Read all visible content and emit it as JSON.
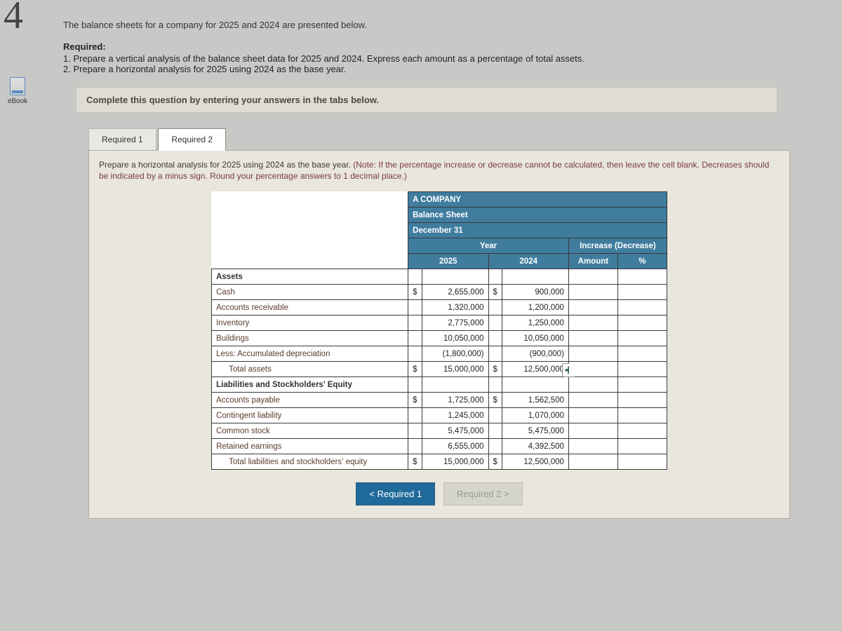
{
  "question_number": "4",
  "sidebar": {
    "ebook_label": "eBook"
  },
  "intro": "The balance sheets for a company for 2025 and 2024 are presented below.",
  "required_heading": "Required:",
  "required_items": [
    "1. Prepare a vertical analysis of the balance sheet data for 2025 and 2024. Express each amount as a percentage of total assets.",
    "2. Prepare a horizontal analysis for 2025 using 2024 as the base year."
  ],
  "complete_bar": "Complete this question by entering your answers in the tabs below.",
  "tabs": {
    "t1": "Required 1",
    "t2": "Required 2"
  },
  "instruction_main": "Prepare a horizontal analysis for 2025 using 2024 as the base year. ",
  "instruction_note": "(Note: If the percentage increase or decrease cannot be calculated, then leave the cell blank. Decreases should be indicated by a minus sign. Round your percentage answers to 1 decimal place.)",
  "table": {
    "title1": "A COMPANY",
    "title2": "Balance Sheet",
    "title3": "December 31",
    "year_hdr": "Year",
    "inc_hdr": "Increase (Decrease)",
    "col_2025": "2025",
    "col_2024": "2024",
    "col_amount": "Amount",
    "col_pct": "%",
    "sections": {
      "assets": "Assets",
      "liab": "Liabilities and Stockholders' Equity"
    },
    "rows": [
      {
        "label": "Cash",
        "c25": "$",
        "v25": "2,655,000",
        "c24": "$",
        "v24": "900,000"
      },
      {
        "label": "Accounts receivable",
        "v25": "1,320,000",
        "v24": "1,200,000"
      },
      {
        "label": "Inventory",
        "v25": "2,775,000",
        "v24": "1,250,000"
      },
      {
        "label": "Buildings",
        "v25": "10,050,000",
        "v24": "10,050,000"
      },
      {
        "label": "Less: Accumulated depreciation",
        "v25": "(1,800,000)",
        "v24": "(900,000)"
      },
      {
        "label": "Total assets",
        "indent": true,
        "c25": "$",
        "v25": "15,000,000",
        "c24": "$",
        "v24": "12,500,000"
      }
    ],
    "rows2": [
      {
        "label": "Accounts payable",
        "c25": "$",
        "v25": "1,725,000",
        "c24": "$",
        "v24": "1,562,500"
      },
      {
        "label": "Contingent liability",
        "v25": "1,245,000",
        "v24": "1,070,000"
      },
      {
        "label": "Common stock",
        "v25": "5,475,000",
        "v24": "5,475,000"
      },
      {
        "label": "Retained earnings",
        "v25": "6,555,000",
        "v24": "4,392,500"
      },
      {
        "label": "Total liabilities and stockholders' equity",
        "indent": true,
        "c25": "$",
        "v25": "15,000,000",
        "c24": "$",
        "v24": "12,500,000"
      }
    ]
  },
  "nav": {
    "prev": "<  Required 1",
    "next": "Required 2  >"
  }
}
